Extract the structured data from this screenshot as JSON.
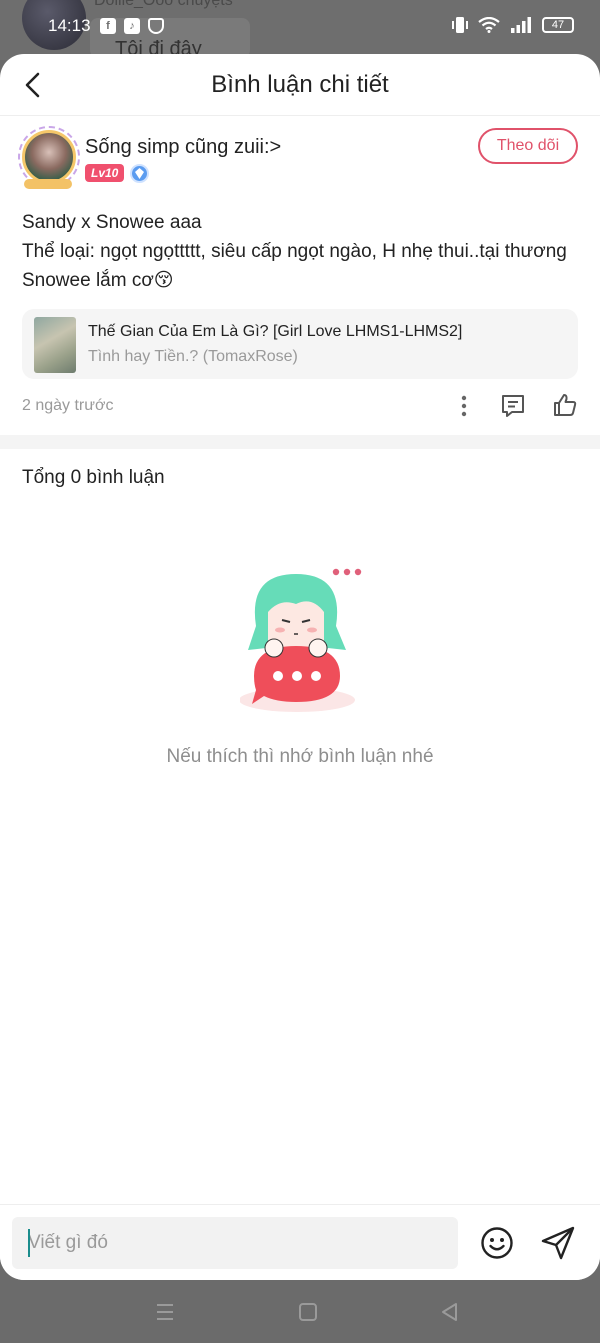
{
  "background": {
    "name": "Dolile_Ooo chuyệts",
    "bubble_text": "Tôi đi đây"
  },
  "status_bar": {
    "time": "14:13",
    "battery": "47"
  },
  "header": {
    "title": "Bình luận chi tiết"
  },
  "author": {
    "name": "Sống simp cũng zuii:>",
    "level": "Lv10",
    "follow_label": "Theo dõi"
  },
  "post": {
    "lines": [
      "Sandy x Snowee aaa",
      "Thể loại: ngọt ngọttttt, siêu cấp ngọt ngào, H nhẹ thui..tại thương Snowee lắm cơ😚"
    ],
    "time": "2 ngày trước"
  },
  "song": {
    "title": "Thế Gian Của Em Là Gì? [Girl Love LHMS1-LHMS2]",
    "subtitle": "Tình hay Tiền.? (TomaxRose)"
  },
  "comments": {
    "count_label": "Tổng 0 bình luận",
    "empty_text": "Nếu thích thì nhớ bình luận nhé"
  },
  "composer": {
    "placeholder": "Viết gì đó"
  },
  "colors": {
    "accent": "#e0526a",
    "badge": "#f0506e",
    "verify": "#5b9cf0"
  }
}
